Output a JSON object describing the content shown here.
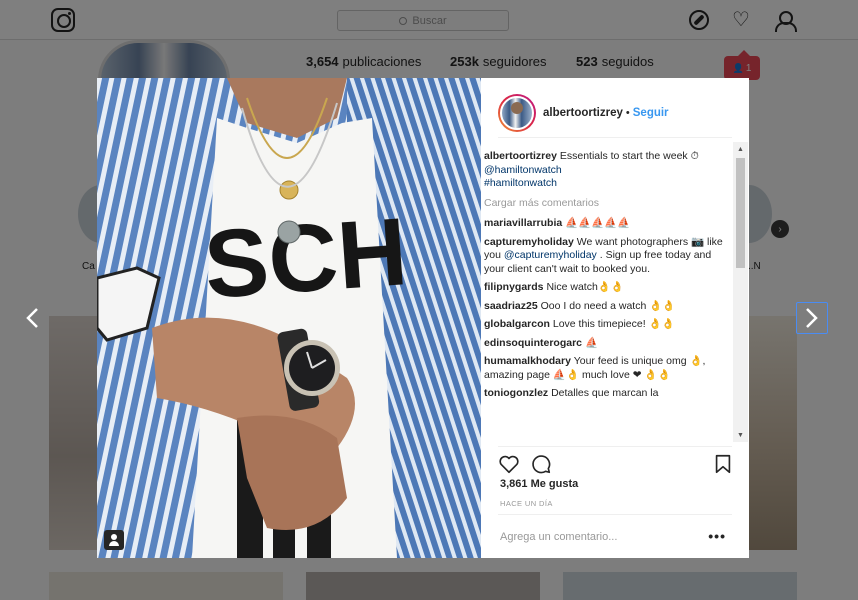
{
  "nav": {
    "search_placeholder": "Buscar"
  },
  "profile": {
    "posts_count": "3,654",
    "posts_label": "publicaciones",
    "followers_count": "253k",
    "followers_label": "seguidores",
    "following_count": "523",
    "following_label": "seguidos",
    "notification_count": "1"
  },
  "highlights": [
    {
      "label": "Ca"
    },
    {
      "label": "..N"
    }
  ],
  "post": {
    "username": "albertoortizrey",
    "separator": "•",
    "follow_label": "Seguir",
    "caption_user": "albertoortizrey",
    "caption_text": "Essentials to start the week ⏱",
    "caption_mention": "@hamiltonwatch",
    "caption_hashtag": "#hamiltonwatch",
    "load_more": "Cargar más comentarios",
    "comments": [
      {
        "user": "mariavillarrubia",
        "text": "⛵⛵⛵⛵⛵"
      },
      {
        "user": "capturemyholiday",
        "text": "We want photographers 📷 like you",
        "mention": "@capturemyholiday",
        "text_after": ". Sign up free today and your client can't wait to booked you."
      },
      {
        "user": "filipnygards",
        "text": "Nice watch👌👌"
      },
      {
        "user": "saadriaz25",
        "text": "Ooo I do need a watch 👌👌"
      },
      {
        "user": "globalgarcon",
        "text": "Love this timepiece! 👌👌"
      },
      {
        "user": "edinsoquinterogarc",
        "text": "⛵"
      },
      {
        "user": "humamalkhodary",
        "text": "Your feed is unique omg 👌, amazing page ⛵👌 much love ❤ 👌👌"
      },
      {
        "user": "toniogonzlez",
        "text": "Detalles que marcan la"
      }
    ],
    "likes": "3,861 Me gusta",
    "time_ago": "HACE UN DÍA",
    "add_comment_placeholder": "Agrega un comentario...",
    "more_label": "•••"
  },
  "colors": {
    "accent": "#3897f0",
    "link": "#003569",
    "overlay": "rgba(0,0,0,0.5)"
  }
}
